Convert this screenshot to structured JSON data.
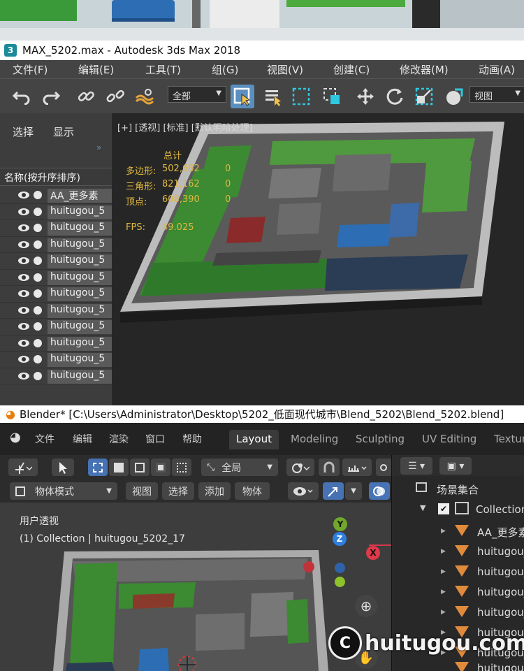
{
  "max": {
    "title": "MAX_5202.max - Autodesk 3ds Max 2018",
    "icon_label": "3",
    "menu": [
      "文件(F)",
      "编辑(E)",
      "工具(T)",
      "组(G)",
      "视图(V)",
      "创建(C)",
      "修改器(M)",
      "动画(A)"
    ],
    "toolbar": {
      "filter_value": "全部",
      "view_value": "视图"
    },
    "explorer": {
      "tab_select": "选择",
      "tab_display": "显示",
      "column_header": "名称(按升序排序)",
      "rows": [
        "AA_更多素",
        "huitugou_5",
        "huitugou_5",
        "huitugou_5",
        "huitugou_5",
        "huitugou_5",
        "huitugou_5",
        "huitugou_5",
        "huitugou_5",
        "huitugou_5",
        "huitugou_5",
        "huitugou_5"
      ]
    },
    "viewport": {
      "label": "[+] [透视] [标准] [默认明暗处理]",
      "stats": {
        "total_label": "总计",
        "poly_label": "多边形:",
        "poly_value": "502,662",
        "poly_sel": "0",
        "tri_label": "三角形:",
        "tri_value": "821,162",
        "tri_sel": "0",
        "vert_label": "顶点:",
        "vert_value": "608,390",
        "vert_sel": "0",
        "fps_label": "FPS:",
        "fps_value": "49.025"
      }
    }
  },
  "blender": {
    "title": "Blender* [C:\\Users\\Administrator\\Desktop\\5202_低面现代城市\\Blend_5202\\Blend_5202.blend]",
    "menu": [
      "文件",
      "编辑",
      "渲染",
      "窗口",
      "帮助"
    ],
    "workspaces": [
      "Layout",
      "Modeling",
      "Sculpting",
      "UV Editing",
      "Texture"
    ],
    "header": {
      "orientation": "全局",
      "mode": "物体模式",
      "view": "视图",
      "select": "选择",
      "add": "添加",
      "object": "物体"
    },
    "viewport": {
      "view_name": "用户透视",
      "collection_line": "(1) Collection | huitugou_5202_17",
      "gizmo": {
        "y": "Y",
        "z": "Z",
        "x": "X"
      }
    },
    "outliner": {
      "scene_collection": "场景集合",
      "collection": "Collection",
      "items": [
        "AA_更多素",
        "huitugou_",
        "huitugou_",
        "huitugou_",
        "huitugou_",
        "huitugou_",
        "huitugou_",
        "huitugou_"
      ]
    },
    "watermark": "huitugou.com"
  },
  "colors": {
    "max_bg": "#444444",
    "blender_accent": "#4772b3",
    "stat_yellow": "#e0b840",
    "green": "#3fa83f",
    "orange_tri": "#e08a3c"
  }
}
